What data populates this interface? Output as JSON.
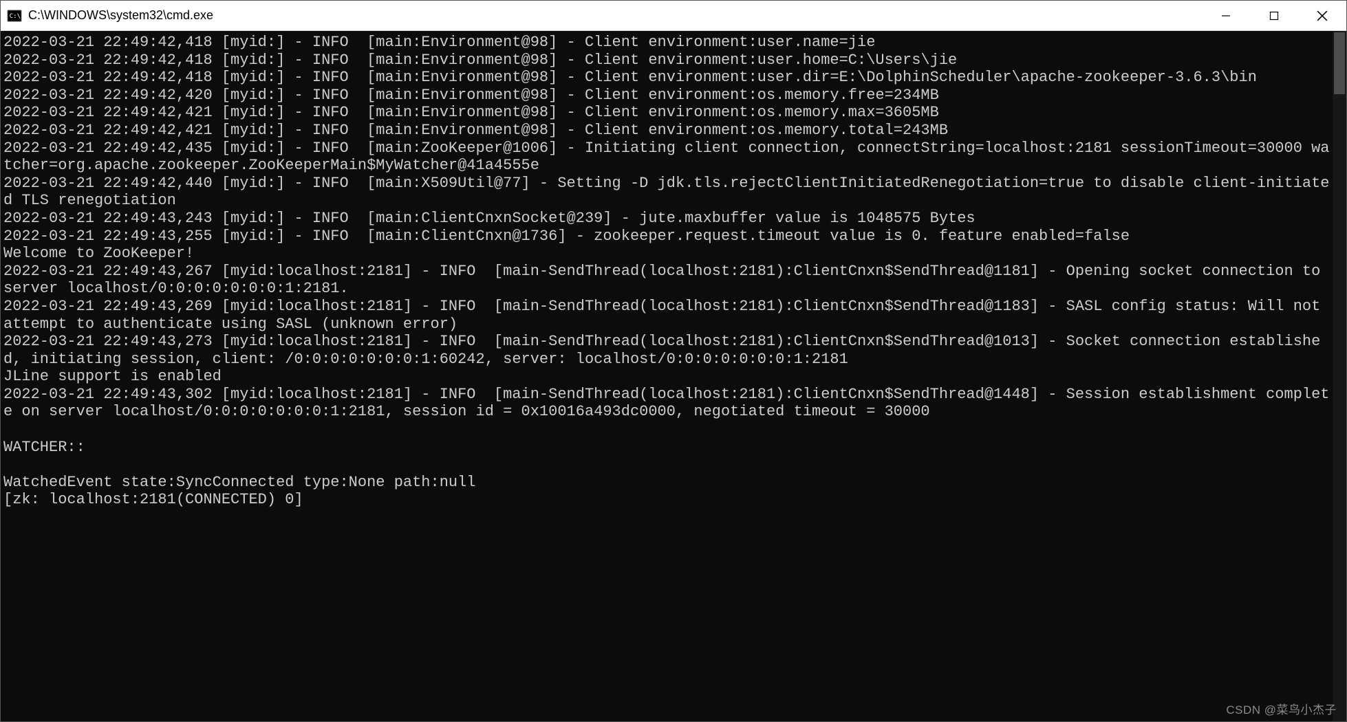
{
  "window": {
    "title": "C:\\WINDOWS\\system32\\cmd.exe"
  },
  "terminal": {
    "lines": [
      "2022-03-21 22:49:42,418 [myid:] - INFO  [main:Environment@98] - Client environment:user.name=jie",
      "2022-03-21 22:49:42,418 [myid:] - INFO  [main:Environment@98] - Client environment:user.home=C:\\Users\\jie",
      "2022-03-21 22:49:42,418 [myid:] - INFO  [main:Environment@98] - Client environment:user.dir=E:\\DolphinScheduler\\apache-zookeeper-3.6.3\\bin",
      "2022-03-21 22:49:42,420 [myid:] - INFO  [main:Environment@98] - Client environment:os.memory.free=234MB",
      "2022-03-21 22:49:42,421 [myid:] - INFO  [main:Environment@98] - Client environment:os.memory.max=3605MB",
      "2022-03-21 22:49:42,421 [myid:] - INFO  [main:Environment@98] - Client environment:os.memory.total=243MB",
      "2022-03-21 22:49:42,435 [myid:] - INFO  [main:ZooKeeper@1006] - Initiating client connection, connectString=localhost:2181 sessionTimeout=30000 watcher=org.apache.zookeeper.ZooKeeperMain$MyWatcher@41a4555e",
      "2022-03-21 22:49:42,440 [myid:] - INFO  [main:X509Util@77] - Setting -D jdk.tls.rejectClientInitiatedRenegotiation=true to disable client-initiated TLS renegotiation",
      "2022-03-21 22:49:43,243 [myid:] - INFO  [main:ClientCnxnSocket@239] - jute.maxbuffer value is 1048575 Bytes",
      "2022-03-21 22:49:43,255 [myid:] - INFO  [main:ClientCnxn@1736] - zookeeper.request.timeout value is 0. feature enabled=false",
      "Welcome to ZooKeeper!",
      "2022-03-21 22:49:43,267 [myid:localhost:2181] - INFO  [main-SendThread(localhost:2181):ClientCnxn$SendThread@1181] - Opening socket connection to server localhost/0:0:0:0:0:0:0:1:2181.",
      "2022-03-21 22:49:43,269 [myid:localhost:2181] - INFO  [main-SendThread(localhost:2181):ClientCnxn$SendThread@1183] - SASL config status: Will not attempt to authenticate using SASL (unknown error)",
      "2022-03-21 22:49:43,273 [myid:localhost:2181] - INFO  [main-SendThread(localhost:2181):ClientCnxn$SendThread@1013] - Socket connection established, initiating session, client: /0:0:0:0:0:0:0:1:60242, server: localhost/0:0:0:0:0:0:0:1:2181",
      "JLine support is enabled",
      "2022-03-21 22:49:43,302 [myid:localhost:2181] - INFO  [main-SendThread(localhost:2181):ClientCnxn$SendThread@1448] - Session establishment complete on server localhost/0:0:0:0:0:0:0:1:2181, session id = 0x10016a493dc0000, negotiated timeout = 30000",
      "",
      "WATCHER::",
      "",
      "WatchedEvent state:SyncConnected type:None path:null",
      "[zk: localhost:2181(CONNECTED) 0]"
    ]
  },
  "watermark": "CSDN @菜鸟小杰子"
}
